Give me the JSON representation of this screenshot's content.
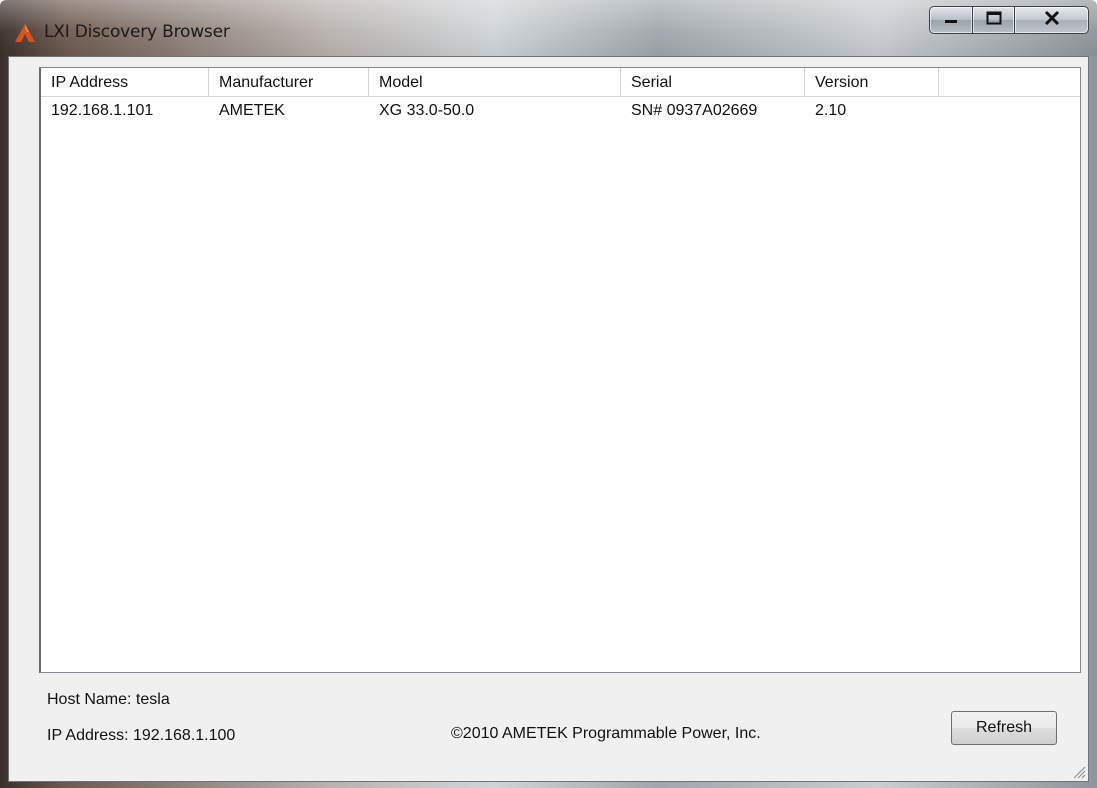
{
  "window": {
    "title": "LXI Discovery Browser",
    "icon": "ametek-logo-icon",
    "buttons": {
      "minimize": "minimize-icon",
      "maximize": "maximize-icon",
      "close": "close-icon"
    }
  },
  "table": {
    "columns": [
      "IP Address",
      "Manufacturer",
      "Model",
      "Serial",
      "Version",
      ""
    ],
    "rows": [
      [
        "192.168.1.101",
        "AMETEK",
        "XG 33.0-50.0",
        "SN# 0937A02669",
        "2.10",
        ""
      ]
    ]
  },
  "footer": {
    "host_name": "Host Name:  tesla",
    "ip_address": "IP Address:  192.168.1.100",
    "copyright": "©2010 AMETEK Programmable Power, Inc.",
    "refresh_label": "Refresh"
  },
  "colors": {
    "accent": "#d9531e"
  }
}
